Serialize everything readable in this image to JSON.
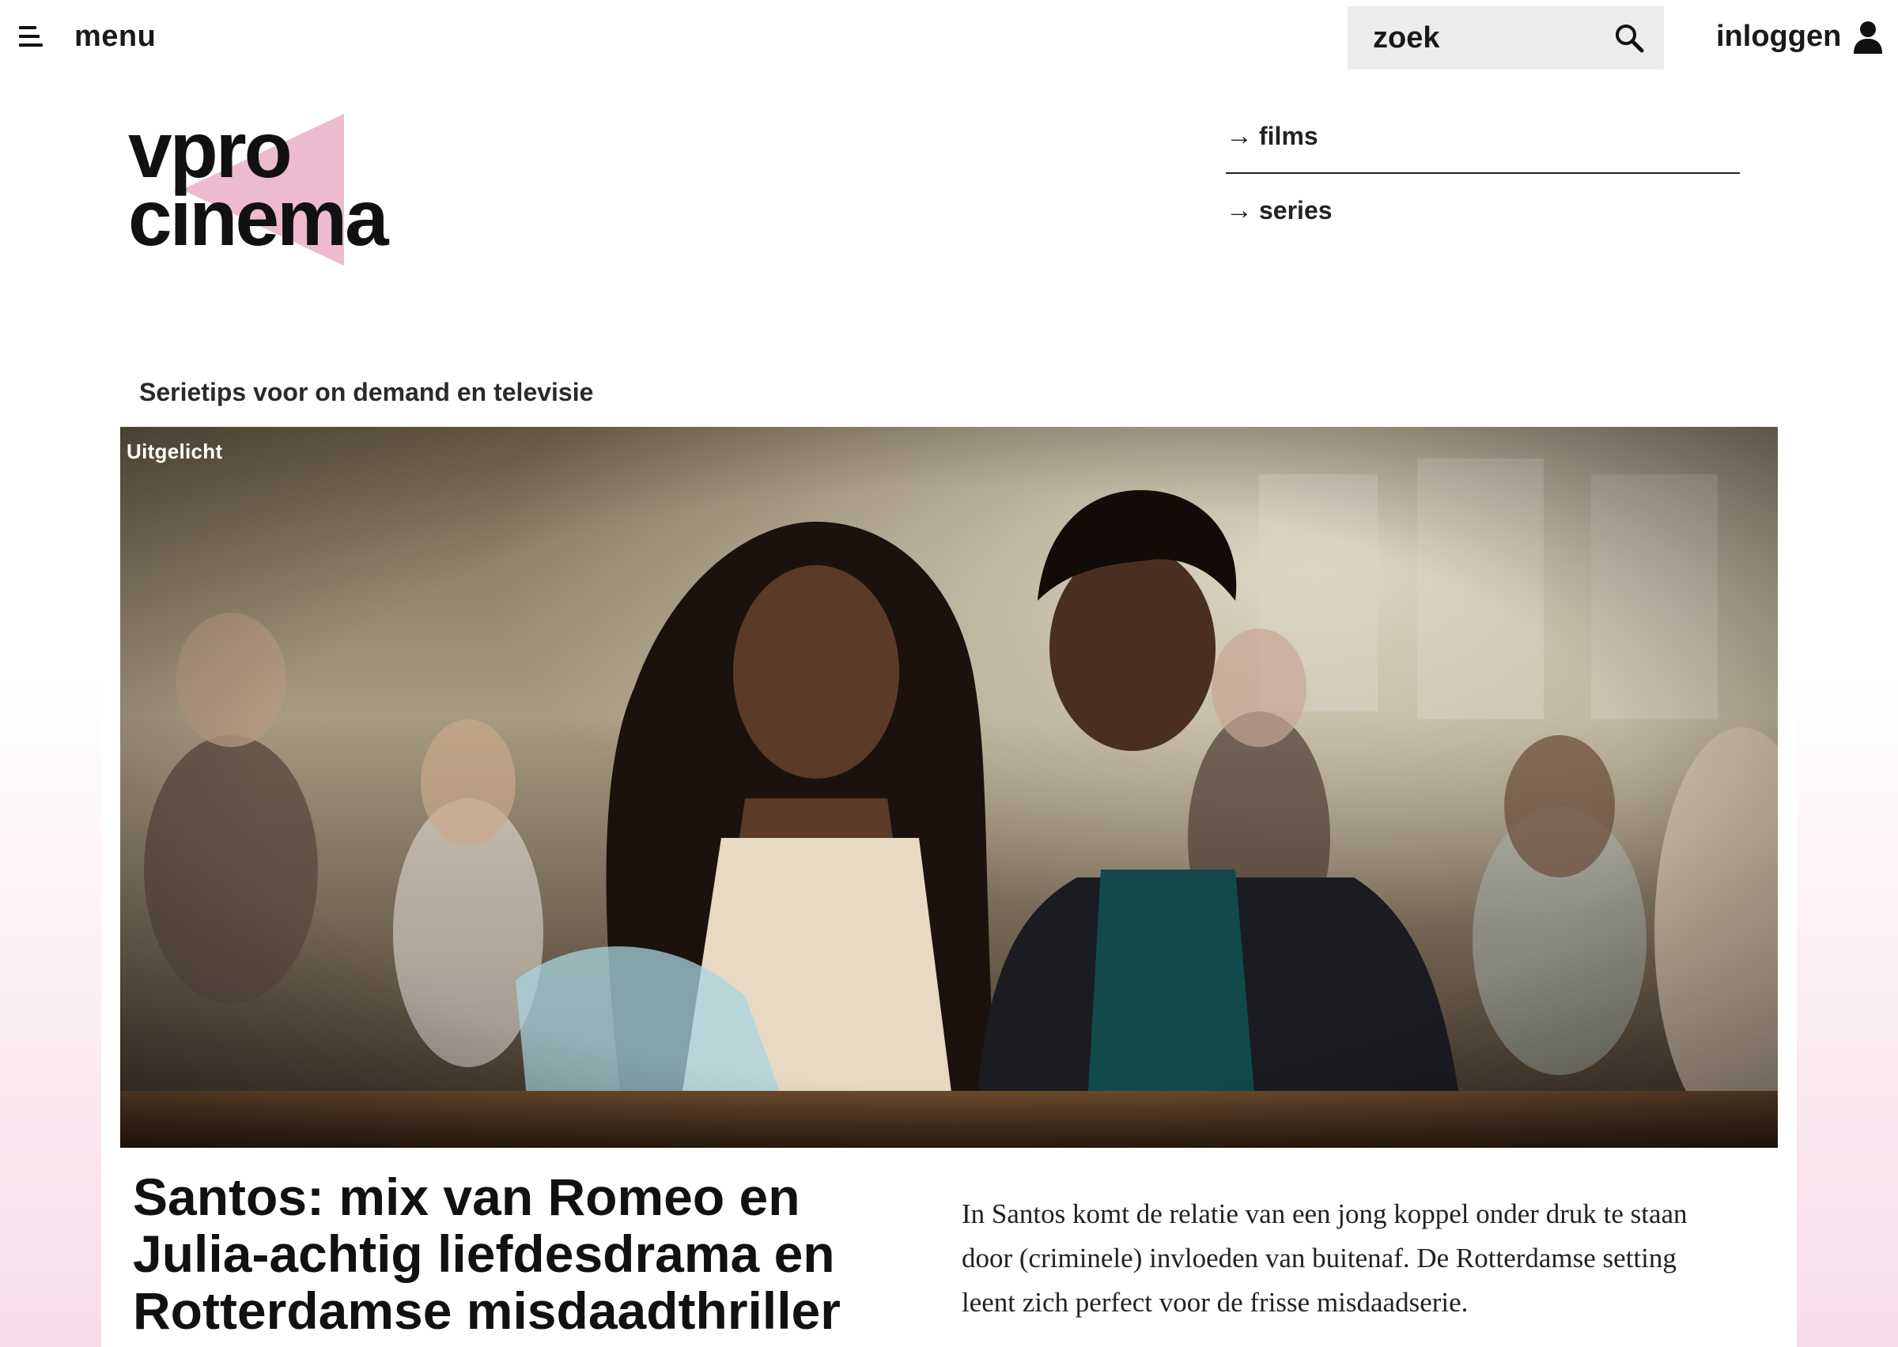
{
  "header": {
    "menu_label": "menu",
    "search_placeholder": "zoek",
    "login_label": "inloggen"
  },
  "logo": {
    "line1": "vpro",
    "line2": "cinema",
    "accent_color": "#e7a3c0"
  },
  "subnav": {
    "items": [
      {
        "label": "films",
        "arrow": "→"
      },
      {
        "label": "series",
        "arrow": "→"
      }
    ]
  },
  "section": {
    "title": "Serietips voor on demand en televisie"
  },
  "featured": {
    "badge": "Uitgelicht",
    "title": "Santos: mix van Romeo en Julia-achtig liefdesdrama en Rotterdamse misdaadthriller",
    "summary": "In Santos komt de relatie van een jong koppel onder druk te staan door (criminele) invloeden van buitenaf. De Rotterdamse setting leent zich perfect voor de frisse misdaadserie."
  },
  "colors": {
    "page_gradient_bottom": "#f7dcea",
    "search_bg": "#ececec",
    "text": "#1a1a1a"
  }
}
